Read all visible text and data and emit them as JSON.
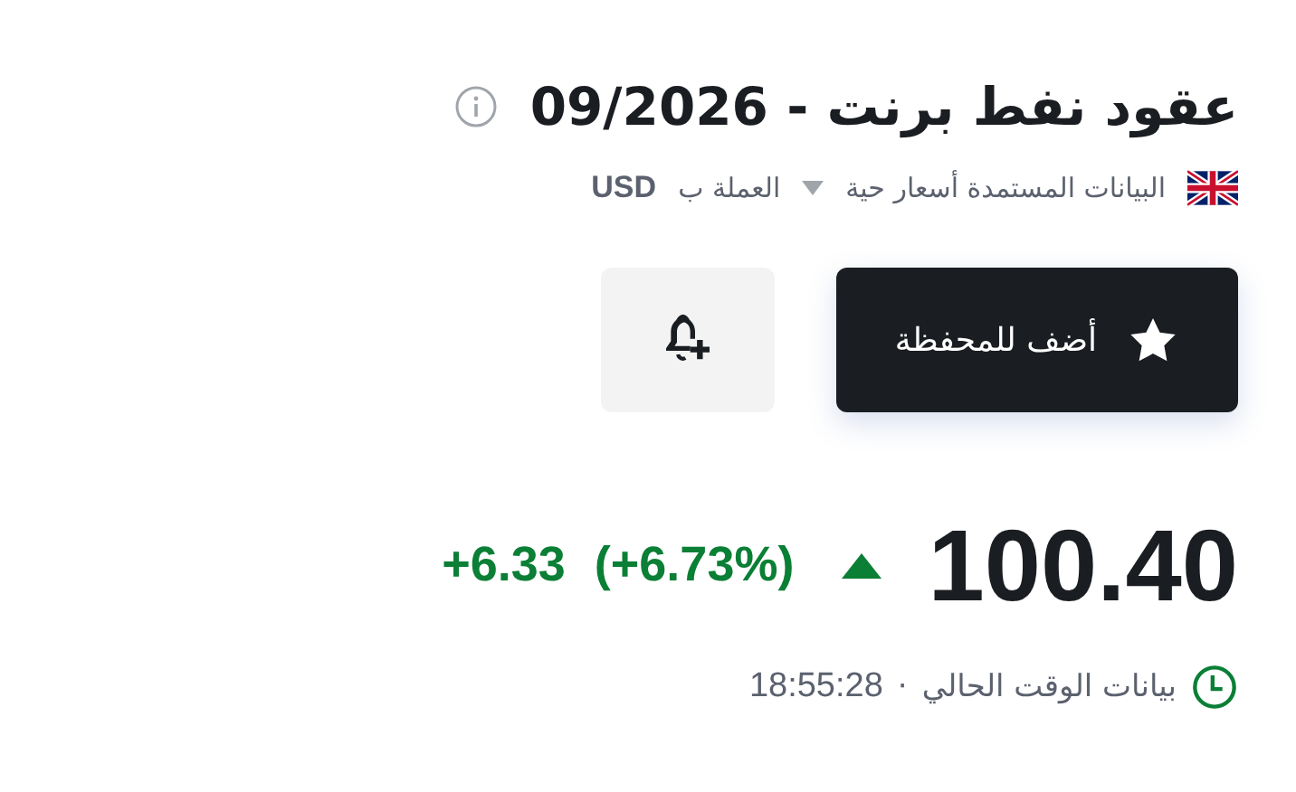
{
  "title": "عقود نفط برنت - 09/2026",
  "meta": {
    "source": "البيانات المستمدة أسعار حية",
    "currency_label": "العملة ب",
    "currency": "USD"
  },
  "buttons": [
    {
      "kind": "portfolio",
      "label": "أضف للمحفظة"
    },
    {
      "kind": "alert"
    }
  ],
  "quote": {
    "price": "100.40",
    "rising": true,
    "change": "+6.33",
    "change_percent": "(+6.73%)"
  },
  "time": {
    "label": "بيانات الوقت الحالي",
    "separator": "·",
    "value": "18:55:28"
  }
}
